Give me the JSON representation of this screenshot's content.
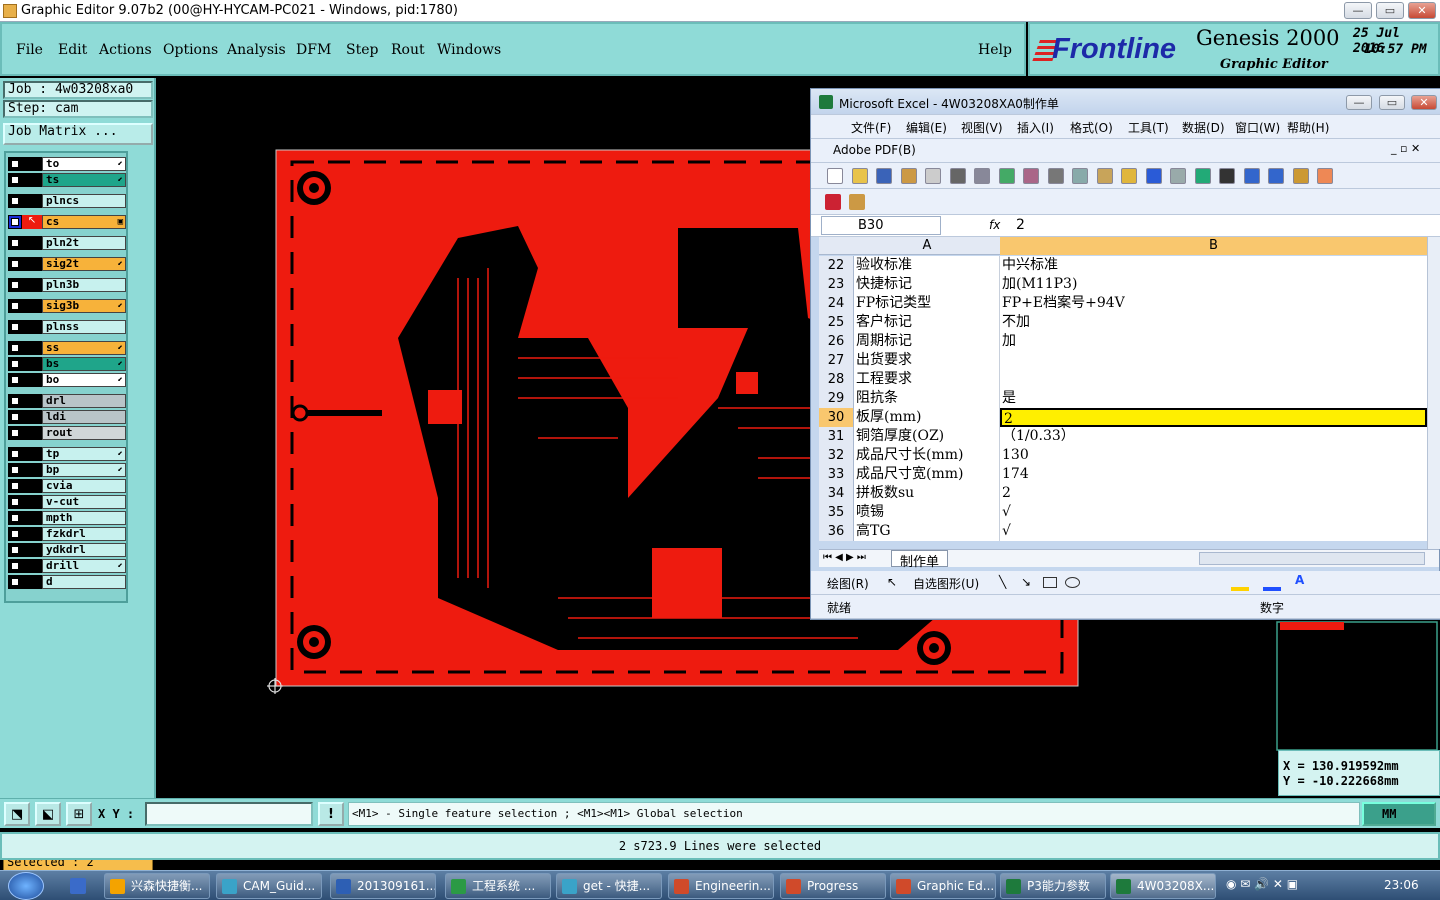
{
  "window": {
    "title": "Graphic Editor 9.07b2 (00@HY-HYCAM-PC021 - Windows, pid:1780)"
  },
  "menu": {
    "items": [
      "File",
      "Edit",
      "Actions",
      "Options",
      "Analysis",
      "DFM",
      "Step",
      "Rout",
      "Windows"
    ],
    "help": "Help"
  },
  "brand": {
    "logo": "Frontline",
    "product": "Genesis 2000",
    "date": "25 Jul 2016",
    "time": "10:57 PM",
    "subtitle": "Graphic Editor"
  },
  "job": {
    "job": "Job : 4w03208xa0",
    "step": "Step: cam",
    "matrix": "Job Matrix ..."
  },
  "layers": [
    {
      "name": "to",
      "color": "#ffffff",
      "sym": "⬋"
    },
    {
      "name": "ts",
      "color": "#1fa58a",
      "sym": "⬋"
    },
    {
      "name": "plncs",
      "color": "#c7f1ee",
      "sym": ""
    },
    {
      "name": "cs",
      "color": "#f7b23a",
      "sym": "▣",
      "active": true
    },
    {
      "name": "pln2t",
      "color": "#c7f1ee",
      "sym": ""
    },
    {
      "name": "sig2t",
      "color": "#f7b23a",
      "sym": "⬋"
    },
    {
      "name": "pln3b",
      "color": "#c7f1ee",
      "sym": ""
    },
    {
      "name": "sig3b",
      "color": "#f7b23a",
      "sym": "⬋"
    },
    {
      "name": "plnss",
      "color": "#c7f1ee",
      "sym": ""
    },
    {
      "name": "ss",
      "color": "#f7b23a",
      "sym": "⬋"
    },
    {
      "name": "bs",
      "color": "#1fa58a",
      "sym": "⬋"
    },
    {
      "name": "bo",
      "color": "#ffffff",
      "sym": "⬋"
    },
    {
      "name": "drl",
      "color": "#b9c4c8",
      "sym": ""
    },
    {
      "name": "ldi",
      "color": "#b9c4c8",
      "sym": ""
    },
    {
      "name": "rout",
      "color": "#d0d6d8",
      "sym": ""
    },
    {
      "name": "tp",
      "color": "#c7f1ee",
      "sym": "⬋"
    },
    {
      "name": "bp",
      "color": "#c7f1ee",
      "sym": "⬋"
    },
    {
      "name": "cvia",
      "color": "#c7f1ee",
      "sym": ""
    },
    {
      "name": "v-cut",
      "color": "#c7f1ee",
      "sym": ""
    },
    {
      "name": "mpth",
      "color": "#c7f1ee",
      "sym": ""
    },
    {
      "name": "fzkdrl",
      "color": "#c7f1ee",
      "sym": ""
    },
    {
      "name": "ydkdrl",
      "color": "#c7f1ee",
      "sym": ""
    },
    {
      "name": "drill",
      "color": "#c7f1ee",
      "sym": "⬋"
    },
    {
      "name": "d",
      "color": "#c7f1ee",
      "sym": ""
    }
  ],
  "selected": "Selected : 2",
  "coords": {
    "x": "X  =  130.919592mm",
    "y": "Y  =  -10.222668mm"
  },
  "units": "MM",
  "command": {
    "xy_label": "X Y :",
    "input": "",
    "hint": "<M1> - Single feature selection ; <M1><M1> Global selection"
  },
  "status_message": "2 s723.9 Lines were selected",
  "excel": {
    "title": "Microsoft Excel - 4W03208XA0制作单",
    "menu": [
      "文件(F)",
      "编辑(E)",
      "视图(V)",
      "插入(I)",
      "格式(O)",
      "工具(T)",
      "数据(D)",
      "窗口(W)",
      "帮助(H)"
    ],
    "pdf_menu": "Adobe PDF(B)",
    "name_box": "B30",
    "fx": "fx",
    "formula": "2",
    "col_a": "A",
    "col_b": "B",
    "rows": [
      {
        "n": "22",
        "a": "验收标准",
        "b": "中兴标准"
      },
      {
        "n": "23",
        "a": "快捷标记",
        "b": "加(M11P3)"
      },
      {
        "n": "24",
        "a": "FP标记类型",
        "b": "FP+E档案号+94V"
      },
      {
        "n": "25",
        "a": "客户标记",
        "b": "不加"
      },
      {
        "n": "26",
        "a": "周期标记",
        "b": "加"
      },
      {
        "n": "27",
        "a": "出货要求",
        "b": ""
      },
      {
        "n": "28",
        "a": "工程要求",
        "b": ""
      },
      {
        "n": "29",
        "a": "阻抗条",
        "b": "是"
      },
      {
        "n": "30",
        "a": "板厚(mm)",
        "b": "2",
        "selected": true
      },
      {
        "n": "31",
        "a": "铜箔厚度(OZ)",
        "b": "（1/0.33）"
      },
      {
        "n": "32",
        "a": "成品尺寸长(mm)",
        "b": "130"
      },
      {
        "n": "33",
        "a": "成品尺寸宽(mm)",
        "b": "174"
      },
      {
        "n": "34",
        "a": "拼板数su",
        "b": "2"
      },
      {
        "n": "35",
        "a": "喷锡",
        "b": "√"
      },
      {
        "n": "36",
        "a": "高TG",
        "b": "√"
      }
    ],
    "sheet_tab": "制作单",
    "draw_label": "绘图(R)",
    "autoshape_label": "自选图形(U)",
    "status_ready": "就绪",
    "status_num": "数字"
  },
  "taskbar": {
    "tasks": [
      "兴森快捷衡...",
      "CAM_Guid...",
      "201309161...",
      "工程系统  ...",
      "get - 快捷...",
      "Engineerin...",
      "Progress",
      "Graphic Ed...",
      "P3能力参数",
      "4W03208X..."
    ],
    "clock": "23:06"
  }
}
